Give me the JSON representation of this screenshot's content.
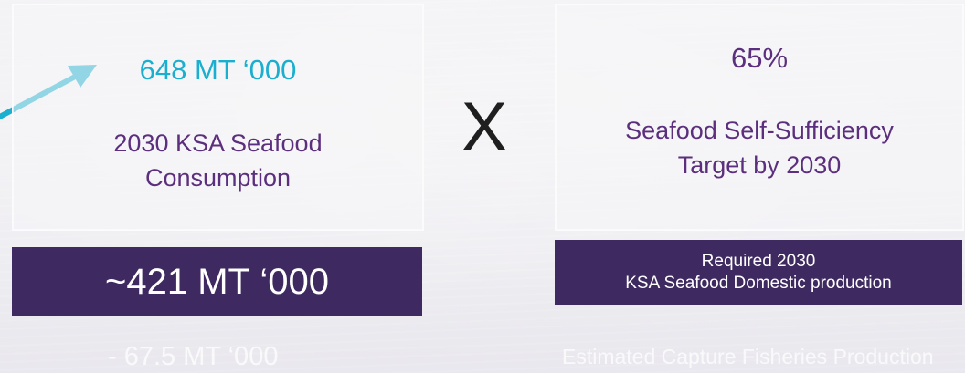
{
  "left_card": {
    "value": "648 MT ‘000",
    "line1": "2030 KSA Seafood",
    "line2": "Consumption"
  },
  "operator": "X",
  "right_card": {
    "value": "65%",
    "line1": "Seafood Self-Sufficiency",
    "line2": "Target by 2030"
  },
  "left_banner": {
    "value": "~421 MT ‘000"
  },
  "right_banner": {
    "line1": "Required 2030",
    "line2": "KSA Seafood Domestic production"
  },
  "faded_rows": {
    "left": "- 67.5 MT ‘000",
    "right": "Estimated Capture Fisheries Production"
  },
  "colors": {
    "teal_accent": "#1aaecf",
    "purple_text": "#5b2f7d",
    "banner_bg": "#3e2a60"
  },
  "icons": {
    "arrow": "arrow-up-right-icon"
  }
}
